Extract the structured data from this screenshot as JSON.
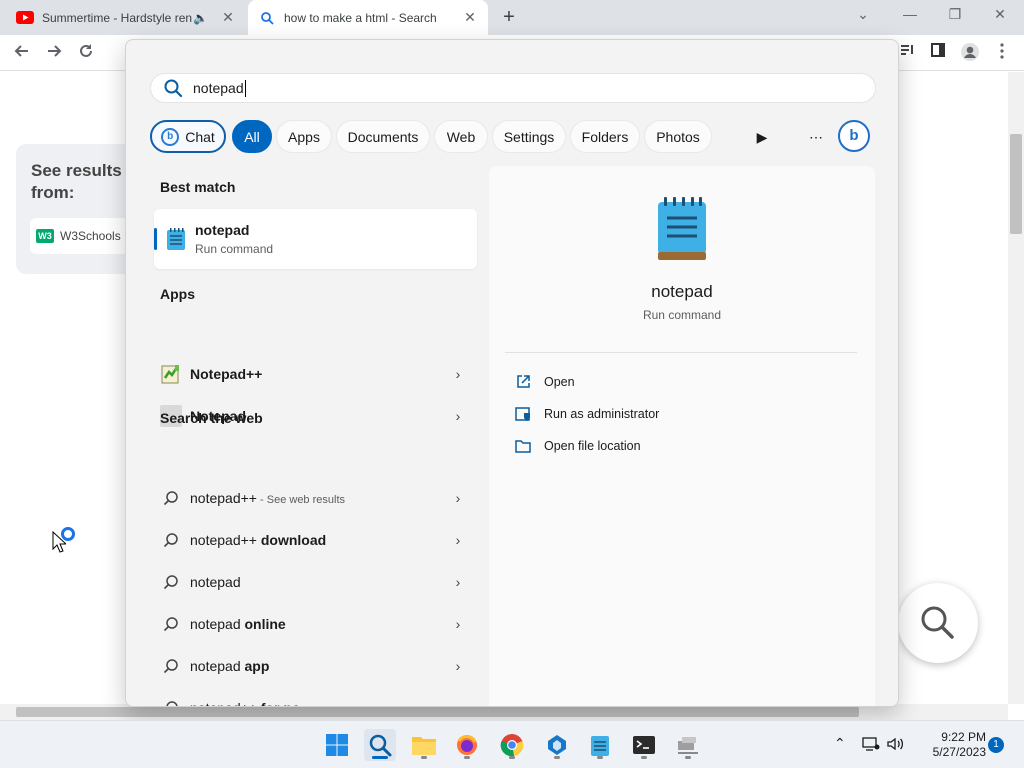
{
  "browser": {
    "tabs": [
      {
        "title": "Summertime - Hardstyle ren",
        "speaker": "🔈",
        "close": "✕"
      },
      {
        "title": "how to make a html - Search",
        "close": "✕"
      }
    ],
    "new_tab": "+",
    "window_controls": {
      "tab_search": "⌄",
      "minimize": "—",
      "restore": "❐",
      "close": "✕"
    }
  },
  "page": {
    "see_results": "See results from:",
    "w3_label": "W3Schools",
    "w3_logo": "W3"
  },
  "search": {
    "query": "notepad"
  },
  "filters": {
    "chat": "Chat",
    "all": "All",
    "apps": "Apps",
    "documents": "Documents",
    "web": "Web",
    "settings": "Settings",
    "folders": "Folders",
    "photos": "Photos",
    "more": "⋯",
    "play": "▶",
    "bing": "b"
  },
  "best_match": {
    "heading": "Best match",
    "name": "notepad",
    "sub": "Run command"
  },
  "apps": {
    "heading": "Apps",
    "items": [
      {
        "label": "Notepad++"
      },
      {
        "label": "Notepad"
      }
    ]
  },
  "web": {
    "heading": "Search the web",
    "items": [
      {
        "base": "notepad++",
        "bold": "",
        "extra": " - See web results"
      },
      {
        "base": "notepad++ ",
        "bold": "download",
        "extra": ""
      },
      {
        "base": "notepad",
        "bold": "",
        "extra": ""
      },
      {
        "base": "notepad ",
        "bold": "online",
        "extra": ""
      },
      {
        "base": "notepad ",
        "bold": "app",
        "extra": ""
      },
      {
        "base": "notepad++ ",
        "bold": "for pc",
        "extra": ""
      }
    ]
  },
  "preview": {
    "name": "notepad",
    "sub": "Run command",
    "actions": [
      "Open",
      "Run as administrator",
      "Open file location"
    ]
  },
  "chevron": "›",
  "taskbar": {
    "time": "9:22 PM",
    "date": "5/27/2023",
    "notifications": "1",
    "tray_chevron": "⌃"
  },
  "colors": {
    "accent": "#0067c0",
    "panel_bg": "#f3f3f3"
  }
}
